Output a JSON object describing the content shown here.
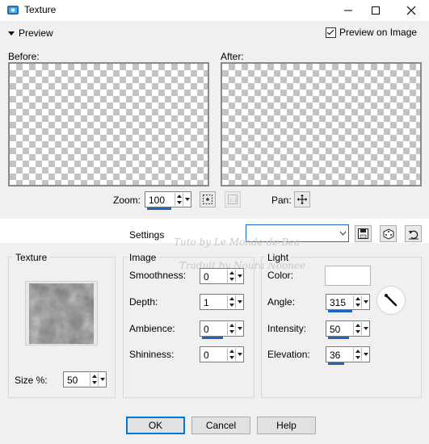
{
  "window": {
    "title": "Texture"
  },
  "preview": {
    "toggle_label": "Preview",
    "on_image_label": "Preview on Image",
    "on_image_checked": true,
    "before_label": "Before:",
    "after_label": "After:",
    "zoom_label": "Zoom:",
    "zoom_value": "100",
    "pan_label": "Pan:"
  },
  "settings": {
    "label": "Settings",
    "value": ""
  },
  "watermark": {
    "line1": "Tuto by Le Monde de Bea",
    "line2": "Traduit by Noura Noonee"
  },
  "texture": {
    "group_label": "Texture",
    "size_label": "Size %:",
    "size_value": "50"
  },
  "image": {
    "group_label": "Image",
    "smoothness_label": "Smoothness:",
    "smoothness_value": "0",
    "depth_label": "Depth:",
    "depth_value": "1",
    "ambience_label": "Ambience:",
    "ambience_value": "0",
    "shininess_label": "Shininess:",
    "shininess_value": "0"
  },
  "light": {
    "group_label": "Light",
    "color_label": "Color:",
    "color_value": "#ffffff",
    "angle_label": "Angle:",
    "angle_value": "315",
    "intensity_label": "Intensity:",
    "intensity_value": "50",
    "elevation_label": "Elevation:",
    "elevation_value": "36"
  },
  "buttons": {
    "ok": "OK",
    "cancel": "Cancel",
    "help": "Help"
  },
  "colors": {
    "accent": "#1e64c8",
    "checker": "#c3c3c3"
  }
}
